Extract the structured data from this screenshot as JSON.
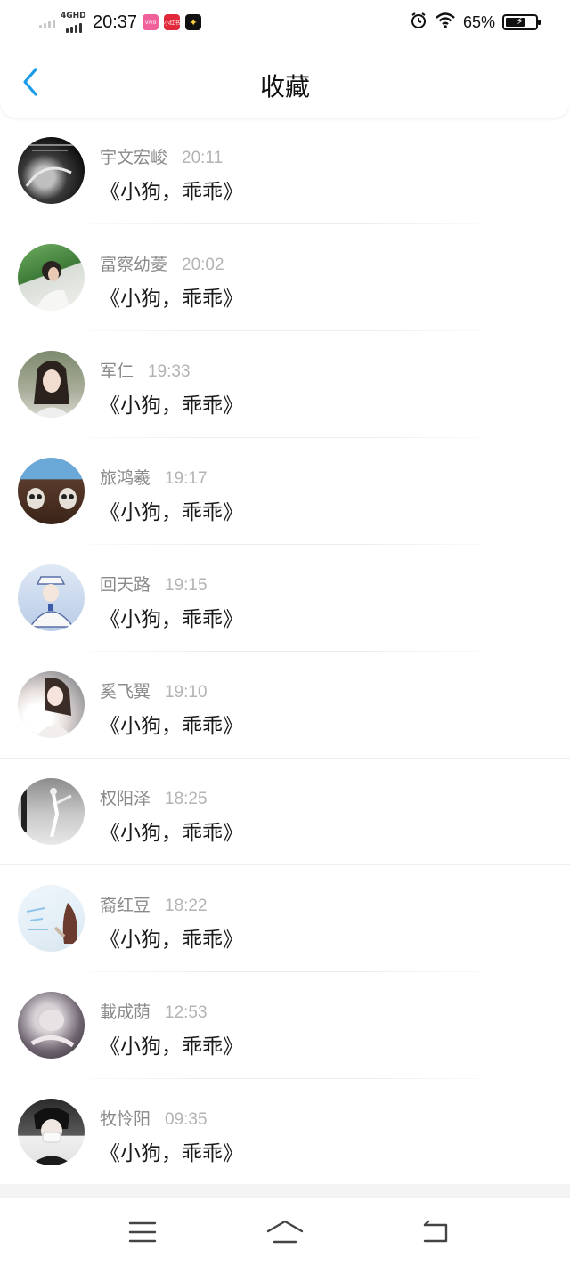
{
  "status_bar": {
    "network_tag": "4GHD",
    "time": "20:37",
    "badges": [
      "vivo",
      "小红书",
      "✦"
    ],
    "battery_percent": "65%",
    "battery_level": 0.65
  },
  "header": {
    "title": "收藏",
    "back_icon": "chevron-left-icon",
    "accent_color": "#1a9be8"
  },
  "favorites": [
    {
      "name": "宇文宏峻",
      "time": "20:11",
      "message": "《小狗，乖乖》"
    },
    {
      "name": "富察幼菱",
      "time": "20:02",
      "message": "《小狗，乖乖》"
    },
    {
      "name": "军仁",
      "time": "19:33",
      "message": "《小狗，乖乖》"
    },
    {
      "name": "旅鸿羲",
      "time": "19:17",
      "message": "《小狗，乖乖》"
    },
    {
      "name": "回天路",
      "time": "19:15",
      "message": "《小狗，乖乖》"
    },
    {
      "name": "奚飞翼",
      "time": "19:10",
      "message": "《小狗，乖乖》"
    },
    {
      "name": "权阳泽",
      "time": "18:25",
      "message": "《小狗，乖乖》"
    },
    {
      "name": "裔红豆",
      "time": "18:22",
      "message": "《小狗，乖乖》"
    },
    {
      "name": "載成荫",
      "time": "12:53",
      "message": "《小狗，乖乖》"
    },
    {
      "name": "牧怜阳",
      "time": "09:35",
      "message": "《小狗，乖乖》"
    }
  ],
  "nav": {
    "menu_icon": "menu-icon",
    "home_icon": "home-icon",
    "back_icon": "back-icon"
  }
}
